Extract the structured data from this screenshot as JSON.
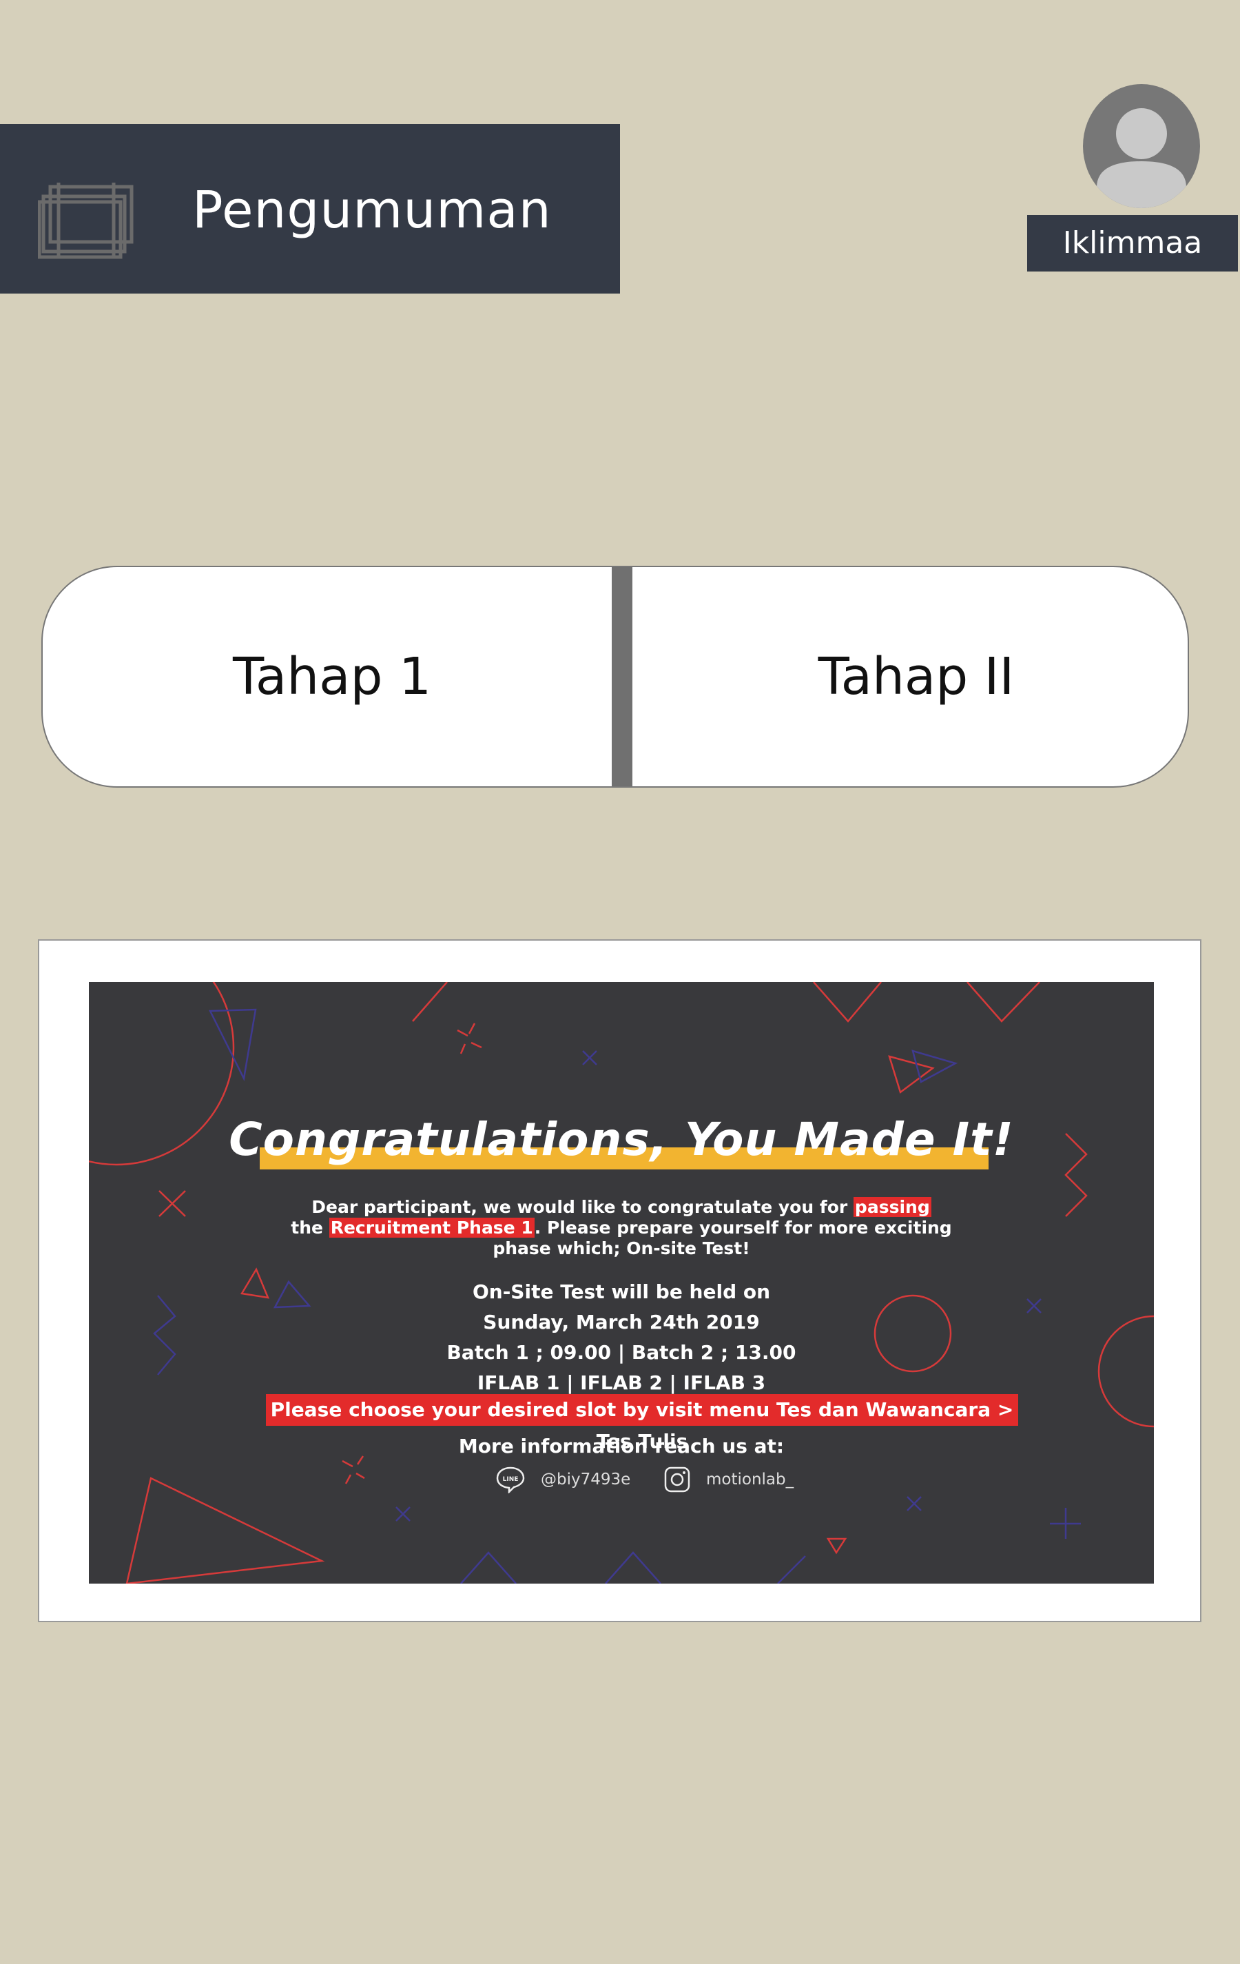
{
  "header": {
    "title": "Pengumuman",
    "icon": "layers-icon"
  },
  "user": {
    "name": "Iklimmaa",
    "avatar_icon": "user-avatar-icon"
  },
  "tabs": [
    {
      "label": "Tahap 1"
    },
    {
      "label": "Tahap II"
    }
  ],
  "announcement": {
    "title": "Congratulations, You Made It!",
    "intro": {
      "line1_pre": "Dear participant, we would like to congratulate you for ",
      "line1_hl": "passing",
      "line2_pre": "the ",
      "line2_hl": "Recruitment Phase 1",
      "line2_post": ". Please prepare yourself for more exciting",
      "line3": "phase which; On-site Test!"
    },
    "schedule": [
      "On-Site Test will be held on",
      "Sunday, March 24th 2019",
      "Batch 1 ; 09.00 | Batch 2 ; 13.00",
      "IFLAB 1 | IFLAB 2 | IFLAB 3"
    ],
    "slot_notice": "Please choose your desired slot by visit menu Tes dan Wawancara > Tes Tulis",
    "more_info": "More information reach us at:",
    "contacts": {
      "line_badge": "LINE",
      "line_id": "@biy7493e",
      "instagram": "motionlab_"
    },
    "colors": {
      "background": "#39393c",
      "accent_red": "#e32b2b",
      "accent_yellow": "#f2b430",
      "accent_blue": "#3f3a8f"
    }
  }
}
